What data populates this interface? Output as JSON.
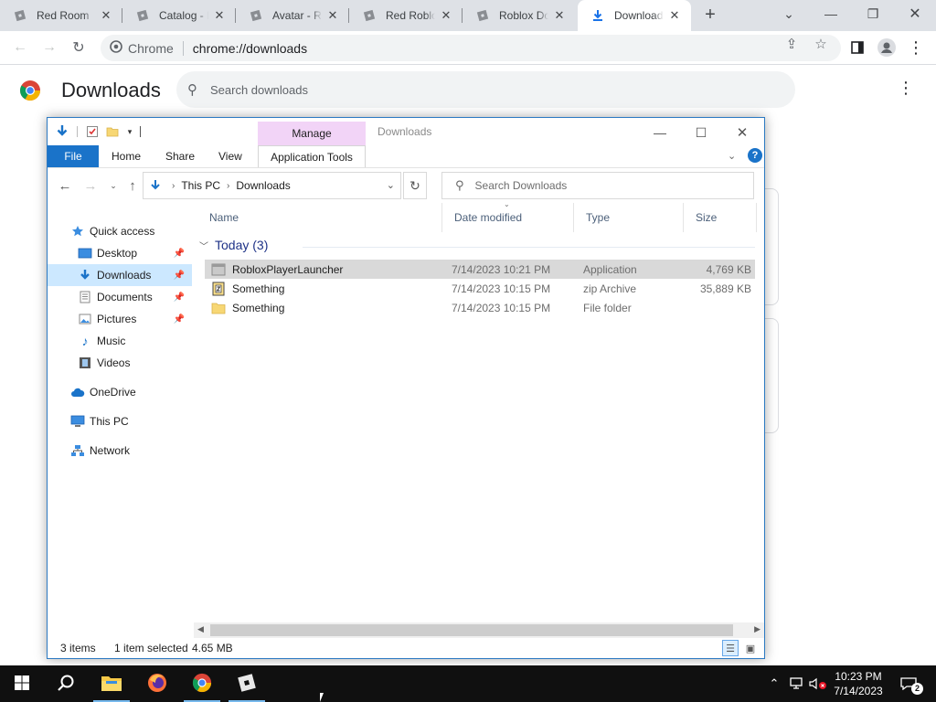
{
  "browser": {
    "tabs": [
      {
        "title": "Red Room",
        "icon": "roblox-icon",
        "active": false
      },
      {
        "title": "Catalog - R",
        "icon": "roblox-icon",
        "active": false
      },
      {
        "title": "Avatar - Ro",
        "icon": "roblox-icon",
        "active": false
      },
      {
        "title": "Red Roblox",
        "icon": "roblox-icon",
        "active": false
      },
      {
        "title": "Roblox Dow",
        "icon": "roblox-icon",
        "active": false
      },
      {
        "title": "Downloads",
        "icon": "download-icon",
        "active": true
      }
    ],
    "omnibox": {
      "site_label": "Chrome",
      "url": "chrome://downloads"
    }
  },
  "downloads_page": {
    "title": "Downloads",
    "search_placeholder": "Search downloads"
  },
  "explorer": {
    "window_title": "Downloads",
    "contextual_tab_group": "Manage",
    "ribbon_tabs": [
      "File",
      "Home",
      "Share",
      "View",
      "Application Tools"
    ],
    "breadcrumb": [
      "This PC",
      "Downloads"
    ],
    "search_placeholder": "Search Downloads",
    "nav_items": [
      {
        "label": "Quick access",
        "icon": "star-icon",
        "pinned": false,
        "selected": false
      },
      {
        "label": "Desktop",
        "icon": "desktop-icon",
        "pinned": true,
        "selected": false
      },
      {
        "label": "Downloads",
        "icon": "download-icon",
        "pinned": true,
        "selected": true
      },
      {
        "label": "Documents",
        "icon": "documents-icon",
        "pinned": true,
        "selected": false
      },
      {
        "label": "Pictures",
        "icon": "pictures-icon",
        "pinned": true,
        "selected": false
      },
      {
        "label": "Music",
        "icon": "music-icon",
        "pinned": false,
        "selected": false
      },
      {
        "label": "Videos",
        "icon": "videos-icon",
        "pinned": false,
        "selected": false
      },
      {
        "label": "OneDrive",
        "icon": "cloud-icon",
        "pinned": false,
        "selected": false
      },
      {
        "label": "This PC",
        "icon": "computer-icon",
        "pinned": false,
        "selected": false
      },
      {
        "label": "Network",
        "icon": "network-icon",
        "pinned": false,
        "selected": false
      }
    ],
    "columns": [
      "Name",
      "Date modified",
      "Type",
      "Size"
    ],
    "group_header": "Today (3)",
    "files": [
      {
        "name": "RobloxPlayerLauncher",
        "date": "7/14/2023 10:21 PM",
        "type": "Application",
        "size": "4,769 KB",
        "icon": "application-icon",
        "selected": true
      },
      {
        "name": "Something",
        "date": "7/14/2023 10:15 PM",
        "type": "zip Archive",
        "size": "35,889 KB",
        "icon": "zip-icon",
        "selected": false
      },
      {
        "name": "Something",
        "date": "7/14/2023 10:15 PM",
        "type": "File folder",
        "size": "",
        "icon": "folder-icon",
        "selected": false
      }
    ],
    "status": {
      "item_count": "3 items",
      "selection": "1 item selected",
      "selection_size": "4.65 MB"
    }
  },
  "taskbar": {
    "clock_time": "10:23 PM",
    "clock_date": "7/14/2023",
    "notification_count": "2"
  },
  "colors": {
    "chrome_tab_bg": "#dee1e6",
    "explorer_accent": "#1a73c9",
    "manage_tab": "#f2d4f7",
    "taskbar": "#101010"
  }
}
